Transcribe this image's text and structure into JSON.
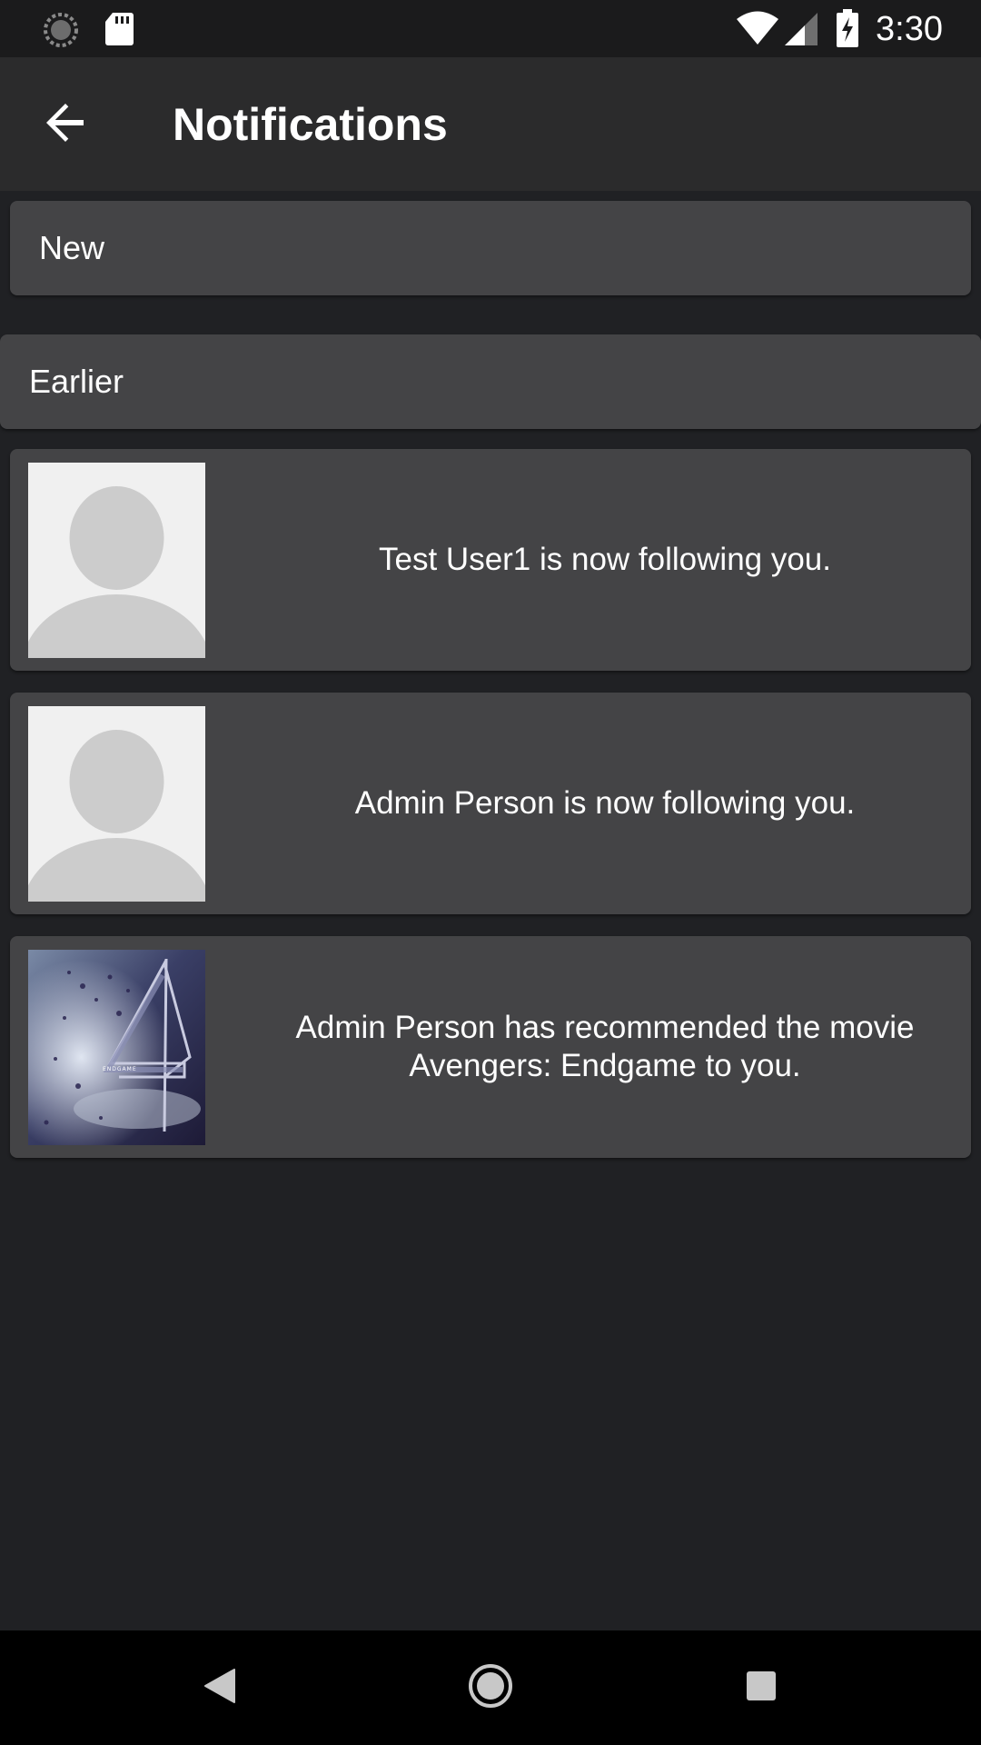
{
  "status_bar": {
    "time": "3:30",
    "left_icons": [
      "sync-icon",
      "sd-card-icon"
    ],
    "right_icons": [
      "wifi-icon",
      "cell-signal-icon",
      "battery-charging-icon"
    ]
  },
  "app_bar": {
    "title": "Notifications",
    "back_icon": "arrow-back-icon"
  },
  "sections": {
    "new_label": "New",
    "earlier_label": "Earlier"
  },
  "notifications": [
    {
      "text": "Test User1 is now following you.",
      "thumbnail": "default-avatar"
    },
    {
      "text": "Admin Person is now following you.",
      "thumbnail": "default-avatar"
    },
    {
      "text": "Admin Person has recommended the movie Avengers: Endgame to you.",
      "thumbnail": "movie-poster",
      "poster_caption": "ENDGAME"
    }
  ],
  "nav_bar": {
    "icons": [
      "nav-back-icon",
      "nav-home-icon",
      "nav-recents-icon"
    ]
  },
  "colors": {
    "background": "#202124",
    "app_bar": "#2b2b2c",
    "card": "#444446",
    "avatar_bg": "#f0f0f0",
    "avatar_fg": "#cccccc"
  }
}
